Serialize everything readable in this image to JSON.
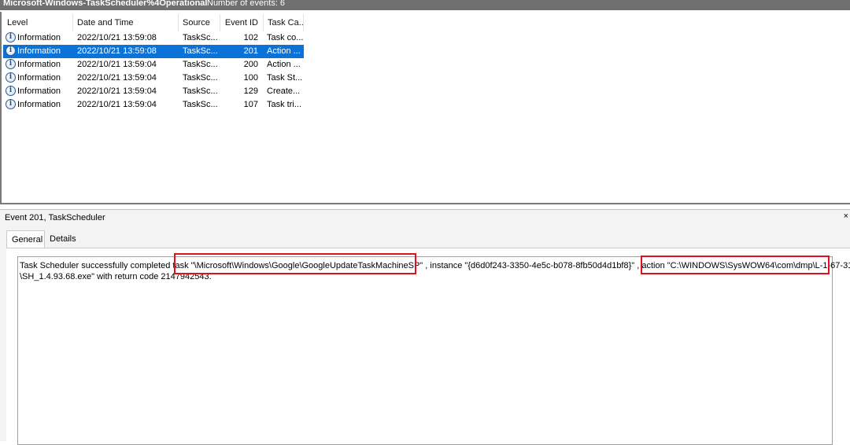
{
  "titlebar": {
    "log_name": "Microsoft-Windows-TaskScheduler%4Operational",
    "count_label": "Number of events: 6"
  },
  "grid": {
    "columns": [
      "Level",
      "Date and Time",
      "Source",
      "Event ID",
      "Task Ca..."
    ],
    "rows": [
      {
        "level": "Information",
        "datetime": "2022/10/21 13:59:08",
        "source": "TaskSc...",
        "event_id": "102",
        "task_category": "Task co..."
      },
      {
        "level": "Information",
        "datetime": "2022/10/21 13:59:08",
        "source": "TaskSc...",
        "event_id": "201",
        "task_category": "Action ..."
      },
      {
        "level": "Information",
        "datetime": "2022/10/21 13:59:04",
        "source": "TaskSc...",
        "event_id": "200",
        "task_category": "Action ..."
      },
      {
        "level": "Information",
        "datetime": "2022/10/21 13:59:04",
        "source": "TaskSc...",
        "event_id": "100",
        "task_category": "Task St..."
      },
      {
        "level": "Information",
        "datetime": "2022/10/21 13:59:04",
        "source": "TaskSc...",
        "event_id": "129",
        "task_category": "Create..."
      },
      {
        "level": "Information",
        "datetime": "2022/10/21 13:59:04",
        "source": "TaskSc...",
        "event_id": "107",
        "task_category": "Task tri..."
      }
    ],
    "selected_index": 1
  },
  "detail": {
    "title": "Event 201, TaskScheduler",
    "tabs": [
      "General",
      "Details"
    ],
    "active_tab": "General",
    "description": {
      "part1": "Task Scheduler successfully completed task ",
      "task_path": "\"\\Microsoft\\Windows\\Google\\GoogleUpdateTaskMachineSP\"",
      "part2": " , instance \"{d6d0f243-3350-4e5c-b078-8fb50d4d1bf8}\" , action ",
      "action_path": "\"C:\\WINDOWS\\SysWOW64\\com\\dmp\\L-1-67-31",
      "line2": "\\SH_1.4.93.68.exe\" with return code 2147942543."
    }
  },
  "icons": {
    "level_icon": "information-icon",
    "info_glyph": "i"
  },
  "colors": {
    "selection": "#0b73d8",
    "highlight_box": "#e1101c",
    "titlebar": "#6f6f6f"
  }
}
